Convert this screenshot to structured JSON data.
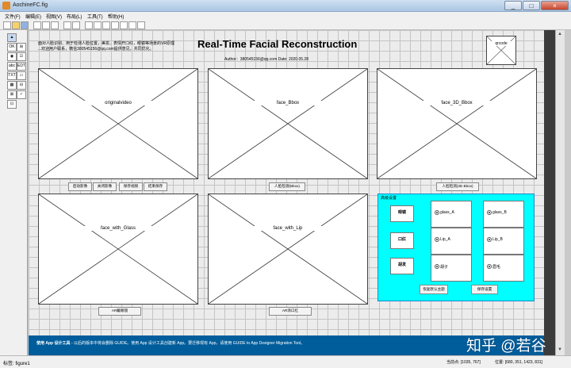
{
  "window": {
    "title": "AochineFC.fig",
    "min": "_",
    "max": "□",
    "close": "×"
  },
  "menu": [
    "文件(F)",
    "编辑(E)",
    "视图(V)",
    "布局(L)",
    "工具(T)",
    "帮助(H)"
  ],
  "palette": [
    "▲",
    "OK",
    "⊞",
    "◉",
    "☑",
    "abc",
    "EDT",
    "TXT",
    "▭",
    "▦",
    "⊟",
    "⊠",
    "✓",
    "⊡"
  ],
  "header": {
    "intro_line1": "面对人脸识别、用于检测人脸位置，美妆、表情开口红，眼镜等场景的VR原理",
    "intro_line2": "...欢迎用户联系，微信380545156@qq.com提供意见，共同优化。",
    "title": "Real-Time Facial Reconstruction",
    "author": "Author：380545156@qq.com   Date: 2020.05.28",
    "qrcode_label": "qrcode"
  },
  "panels": {
    "original": "originalvideo",
    "bbox": "face_Bbox",
    "bbox3d": "face_3D_Bbox",
    "glass": "face_with_Glass",
    "lip": "face_with_Lip"
  },
  "buttons": {
    "start_video": "启动影像",
    "close_video": "关闭影像",
    "save_video": "保存视频",
    "stop_save": "结束保存",
    "face_detect_bbox": "人脸检测(Bbox)",
    "face_detect_3d": "人脸检测(3D Bbox)",
    "ar_glass": "AR戴眼镜",
    "ar_lip": "AR涂口红",
    "restore_default": "恢复默认主题",
    "save_settings": "保存设置"
  },
  "settings": {
    "title": "高级设置",
    "categories": [
      "眼镜",
      "口红",
      "胡发"
    ],
    "options": [
      {
        "label": "glass_A",
        "selected": true
      },
      {
        "label": "glass_B",
        "selected": true
      },
      {
        "label": "Lip_A",
        "selected": true
      },
      {
        "label": "Lip_B",
        "selected": true
      },
      {
        "label": "胡子",
        "selected": true
      },
      {
        "label": "眉毛",
        "selected": true
      }
    ]
  },
  "banner": {
    "bold": "使用 App 设计工具",
    "rest": " - 以后的版本中将会删除 GUIDE。使用 App 设计工具创建新 App。要迁移现有 App，请使用 GUIDE to App Designer Migration Tool。"
  },
  "status": {
    "tag": "标签: figure1",
    "current_point": "当前点: [1035, 767]",
    "position": "位置: [680, 351, 1423, 831]"
  },
  "watermark": "知乎 @若谷",
  "colors": {
    "accent": "#00ffff",
    "banner": "#005d9b",
    "canvas": "#ececec"
  }
}
